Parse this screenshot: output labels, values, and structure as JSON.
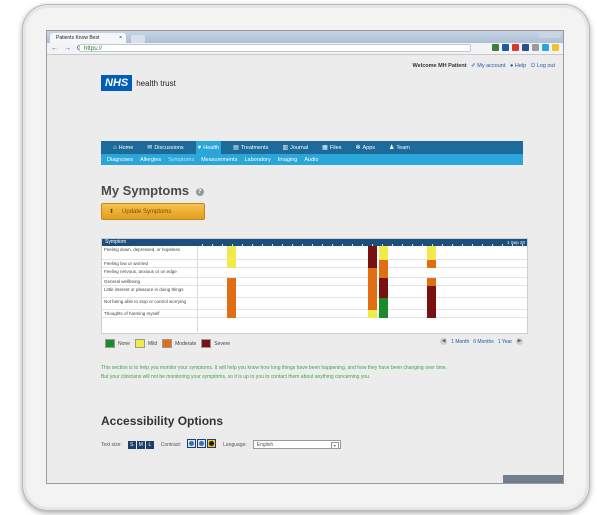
{
  "browser": {
    "tab_title": "Patients Know Best",
    "tab_close": "×",
    "nav_arrows": "← → C",
    "url": "https://",
    "window_controls": "",
    "icon_colors": [
      "#3b7f3b",
      "#1f58a6",
      "#d43b2d",
      "#2c4f8a",
      "#9a9a9a",
      "#2aa7d8",
      "#f2c12e"
    ]
  },
  "header": {
    "welcome": "Welcome MH Patient",
    "my_account": "My account",
    "help": "Help",
    "logout": "Log out",
    "logo_badge": "NHS",
    "logo_text": "health trust"
  },
  "main_nav": [
    {
      "label": "Home",
      "icon": "home-icon",
      "glyph": "⌂"
    },
    {
      "label": "Discussions",
      "icon": "discussions-icon",
      "glyph": "✉"
    },
    {
      "label": "Health",
      "icon": "heart-icon",
      "glyph": "♥"
    },
    {
      "label": "Treatments",
      "icon": "treatments-icon",
      "glyph": "▤"
    },
    {
      "label": "Journal",
      "icon": "journal-icon",
      "glyph": "▥"
    },
    {
      "label": "Files",
      "icon": "files-icon",
      "glyph": "▦"
    },
    {
      "label": "Apps",
      "icon": "apps-icon",
      "glyph": "✻"
    },
    {
      "label": "Team",
      "icon": "team-icon",
      "glyph": "♟"
    }
  ],
  "sub_nav": [
    "Diagnoses",
    "Allergies",
    "Symptoms",
    "Measurements",
    "Laboratory",
    "Imaging",
    "Audio"
  ],
  "page": {
    "title": "My Symptoms",
    "help_glyph": "?",
    "update_button": "Update Symptoms",
    "update_icon": "update-icon"
  },
  "chart_data": {
    "type": "heatmap",
    "header_label": "Symptom",
    "date_label": "1 Sep 20",
    "symptoms": [
      "Feeling down, depressed, or hopeless",
      "Feeling low or worried",
      "Feeling nervous, anxious or on edge",
      "General wellbeing",
      "Little interest or pleasure in doing things",
      "Not being able to stop or control worrying",
      "Thoughts of harming myself"
    ],
    "severity_levels": [
      "None",
      "Mild",
      "Moderate",
      "Severe"
    ],
    "severity_colors": {
      "None": "#1a8a2a",
      "Mild": "#f2ea4a",
      "Moderate": "#e06e12",
      "Severe": "#7a1111"
    },
    "columns": [
      "A",
      "B",
      "C",
      "D",
      "E"
    ],
    "cells": [
      [
        "Mild",
        "",
        "Severe",
        "Mild",
        "Mild"
      ],
      [
        "Mild",
        "",
        "Severe",
        "Moderate",
        "Moderate"
      ],
      [
        "",
        "",
        "Moderate",
        "Moderate",
        ""
      ],
      [
        "Moderate",
        "",
        "Moderate",
        "Severe",
        "Moderate"
      ],
      [
        "Moderate",
        "",
        "Moderate",
        "Severe",
        "Severe"
      ],
      [
        "Moderate",
        "",
        "Moderate",
        "None",
        "Severe"
      ],
      [
        "Moderate",
        "",
        "Mild",
        "None",
        "Severe"
      ]
    ]
  },
  "legend": [
    "None",
    "Mild",
    "Moderate",
    "Severe"
  ],
  "range": {
    "prev": "◀",
    "next": "▶",
    "options": [
      "1 Month",
      "6 Months",
      "1 Year"
    ]
  },
  "info": {
    "line1": "This section is to help you monitor your symptoms. It will help you know how long things have been happening, and how they have been changing over time.",
    "line2": "But your clinicians will not be monitoring your symptoms, so it is up to you to contact them about anything concerning you."
  },
  "accessibility": {
    "title": "Accessibility Options",
    "text_size_label": "Text size:",
    "sizes": [
      "S",
      "M",
      "L"
    ],
    "contrast_label": "Contrast:",
    "contrast_colors": [
      "#3b6fb0",
      "#3b6fb0",
      "#1a1a1a"
    ],
    "language_label": "Language:",
    "language_value": "English",
    "dropdown_glyph": "▾"
  },
  "status_text": ""
}
